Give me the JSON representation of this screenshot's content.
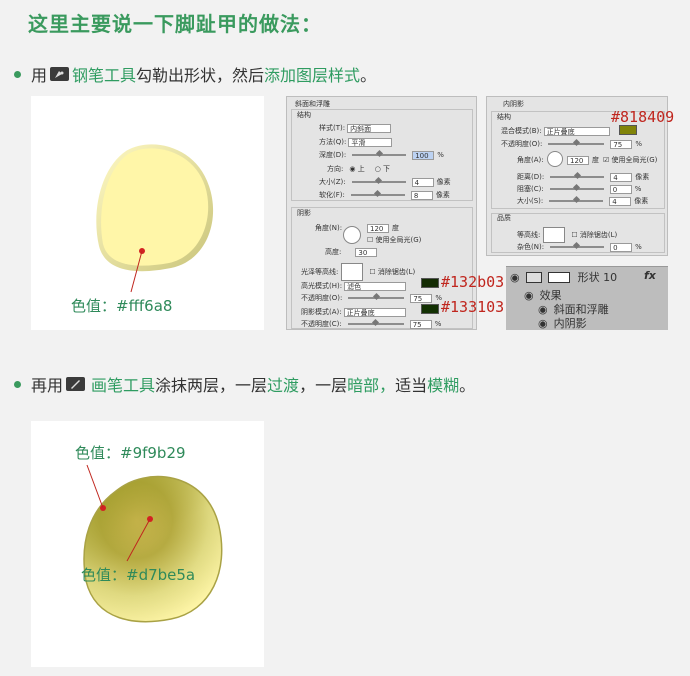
{
  "title": "这里主要说一下脚趾甲的做法：",
  "line1": {
    "prefix": "用",
    "tool": "钢笔工具",
    "mid": "勾勒出形状，然后",
    "action": "添加图层样式",
    "end": "。"
  },
  "line2": {
    "prefix": "再用",
    "tool": "画笔工具",
    "mid1": "涂抹两层，一层",
    "w1": "过渡",
    "mid2": "，一层",
    "w2": "暗部",
    "sep": "，",
    "mid3": "适当",
    "w3": "模糊",
    "end": "。"
  },
  "panel1": {
    "label": "色值：#fff6a8"
  },
  "panel2": {
    "label_top": "色值：#9f9b29",
    "label_mid": "色值：#d7be5a"
  },
  "ps_left": {
    "title": "斜面和浮雕",
    "structure": "结构",
    "style_label": "样式(T):",
    "style_value": "内斜面",
    "method_label": "方法(Q):",
    "method_value": "平滑",
    "depth_label": "深度(D):",
    "depth_value": "100",
    "direction_label": "方向:",
    "dir_up": "上",
    "dir_down": "下",
    "size_label": "大小(Z):",
    "size_value": "4",
    "unit_px": "像素",
    "soften_label": "软化(F):",
    "soften_value": "8",
    "shadow": "阴影",
    "angle_label": "角度(N):",
    "angle_value": "120",
    "degree": "度",
    "global_light": "使用全局光(G)",
    "altitude_label": "高度:",
    "altitude_value": "30",
    "gloss_label": "光泽等高线:",
    "antialias": "消除锯齿(L)",
    "hl_mode_label": "高光模式(H):",
    "hl_mode_value": "滤色",
    "hl_opacity_label": "不透明度(O):",
    "hl_opacity_value": "75",
    "percent": "%",
    "sh_mode_label": "阴影模式(A):",
    "sh_mode_value": "正片叠底",
    "sh_opacity_label": "不透明度(C):",
    "sh_opacity_value": "75",
    "hex_hl": "#132b03",
    "hex_sh": "#133103"
  },
  "ps_right": {
    "title": "内阴影",
    "structure": "结构",
    "blend_label": "混合模式(B):",
    "blend_value": "正片叠底",
    "opacity_label": "不透明度(O):",
    "opacity_value": "75",
    "angle_label": "角度(A):",
    "angle_value": "120",
    "degree": "度",
    "global_light": "使用全局光(G)",
    "distance_label": "距离(D):",
    "distance_value": "4",
    "choke_label": "阻塞(C):",
    "choke_value": "0",
    "size_label": "大小(S):",
    "size_value": "4",
    "quality": "品质",
    "contour_label": "等高线:",
    "antialias": "消除锯齿(L)",
    "noise_label": "杂色(N):",
    "noise_value": "0",
    "unit_px": "像素",
    "percent": "%",
    "hex": "#818409"
  },
  "layers": {
    "layer_name": "形状 10",
    "fx": "fx",
    "effects": "效果",
    "effect1": "斜面和浮雕",
    "effect2": "内阴影"
  },
  "colors": {
    "accent_green": "#3a9a5e",
    "nail_light": "#fff6a8",
    "nail_dark": "#9f9b29",
    "nail_mid": "#d7be5a",
    "swatch_inner_shadow": "#818409",
    "swatch_highlight": "#132b03",
    "swatch_shadow": "#133103",
    "marker_red": "#c0261e"
  }
}
